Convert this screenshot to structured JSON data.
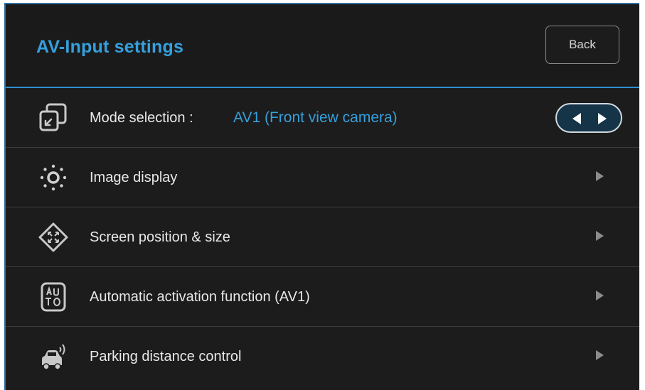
{
  "header": {
    "title": "AV-Input settings",
    "back_label": "Back"
  },
  "rows": [
    {
      "label": "Mode selection :",
      "value": "AV1 (Front view camera)",
      "icon": "mode-selection-icon",
      "control": "prev-next-toggle"
    },
    {
      "label": "Image display",
      "icon": "brightness-icon",
      "control": "chevron-right"
    },
    {
      "label": "Screen position & size",
      "icon": "screen-position-icon",
      "control": "chevron-right"
    },
    {
      "label": "Automatic activation function (AV1)",
      "icon": "auto-icon",
      "control": "chevron-right"
    },
    {
      "label": "Parking distance control",
      "icon": "parking-car-icon",
      "control": "chevron-right"
    }
  ],
  "colors": {
    "background": "#1c1c1c",
    "accent": "#35a0dd",
    "text": "#e8e8e8",
    "divider": "#3c3c3c",
    "arrow": "#8c8c8c"
  }
}
